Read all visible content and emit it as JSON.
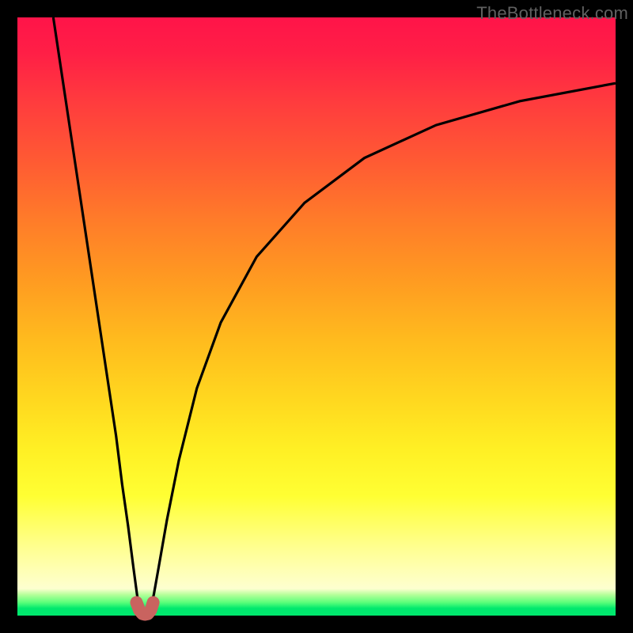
{
  "watermark": {
    "text": "TheBottleneck.com"
  },
  "chart_data": {
    "type": "line",
    "title": "",
    "xlabel": "",
    "ylabel": "",
    "xlim": [
      0,
      100
    ],
    "ylim": [
      0,
      100
    ],
    "grid": false,
    "legend": null,
    "series": [
      {
        "name": "left-branch",
        "x": [
          6.0,
          7.5,
          9.0,
          10.5,
          12.0,
          13.5,
          15.0,
          16.5,
          17.5,
          18.5,
          19.4,
          20.0,
          20.4
        ],
        "y": [
          100.0,
          90.0,
          80.0,
          70.0,
          60.0,
          50.0,
          40.0,
          30.0,
          22.0,
          15.0,
          8.0,
          3.5,
          1.0
        ]
      },
      {
        "name": "right-branch",
        "x": [
          22.2,
          22.8,
          23.6,
          25.0,
          27.0,
          30.0,
          34.0,
          40.0,
          48.0,
          58.0,
          70.0,
          84.0,
          100.0
        ],
        "y": [
          1.0,
          3.5,
          8.0,
          16.0,
          26.0,
          38.0,
          49.0,
          60.0,
          69.0,
          76.5,
          82.0,
          86.0,
          89.0
        ]
      },
      {
        "name": "bottom-highlight",
        "x": [
          19.9,
          20.4,
          20.9,
          21.3,
          21.8,
          22.3,
          22.7
        ],
        "y": [
          2.2,
          0.9,
          0.3,
          0.2,
          0.3,
          0.9,
          2.2
        ]
      }
    ],
    "styles": {
      "left-branch": {
        "stroke": "#000000",
        "width": 3.2
      },
      "right-branch": {
        "stroke": "#000000",
        "width": 3.2
      },
      "bottom-highlight": {
        "stroke": "#c9635f",
        "width": 16,
        "linecap": "round",
        "linejoin": "round"
      }
    },
    "note": "Axes have no tick labels in the source image; x and y are in percent of plot width/height (0 = left/bottom, 100 = right/top). Values are read approximately from the rendered curves."
  }
}
